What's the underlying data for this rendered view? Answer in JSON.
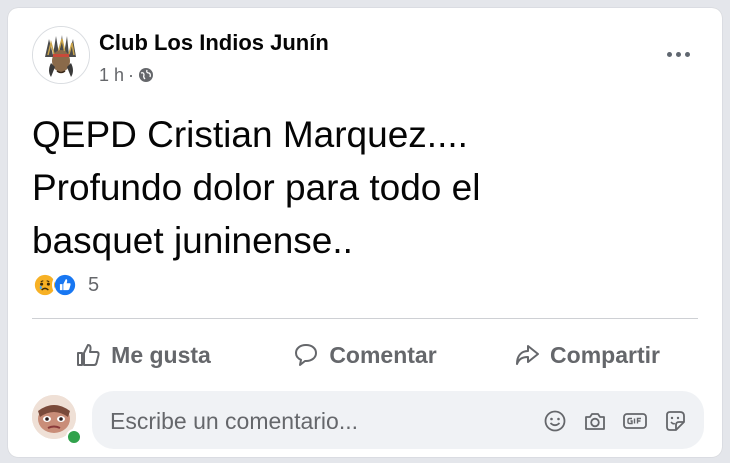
{
  "post": {
    "page_name": "Club Los Indios Junín",
    "time": "1 h",
    "separator": "·",
    "text": "QEPD Cristian Marquez....\nProfundo dolor para todo el\nbasquet juninense..",
    "reaction_count": "5"
  },
  "actions": {
    "like": "Me gusta",
    "comment": "Comentar",
    "share": "Compartir"
  },
  "comment_box": {
    "placeholder": "Escribe un comentario..."
  },
  "colors": {
    "secondary_text": "#65676b",
    "online": "#31a24c",
    "like_blue": "#1877f2",
    "sad_yellow": "#f7b125"
  }
}
